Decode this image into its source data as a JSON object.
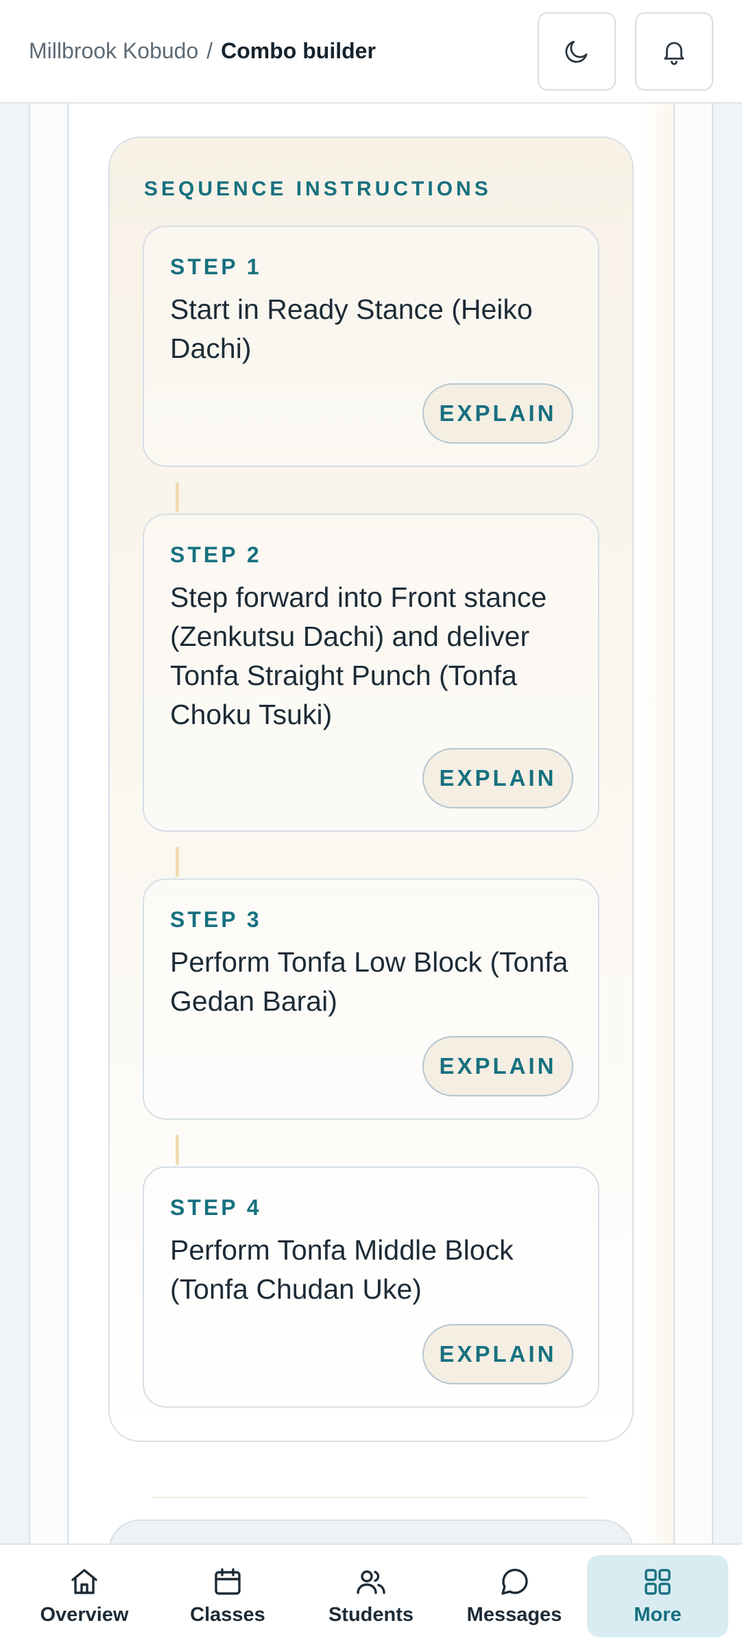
{
  "header": {
    "school_name": "Millbrook Kobudo",
    "separator": "/",
    "page_title": "Combo builder",
    "icons": [
      "moon-icon",
      "bell-icon"
    ]
  },
  "sequence": {
    "title": "SEQUENCE INSTRUCTIONS",
    "steps": [
      {
        "label": "STEP 1",
        "text": "Start in Ready Stance (Heiko Dachi)",
        "button": "EXPLAIN"
      },
      {
        "label": "STEP 2",
        "text": "Step forward into Front stance (Zenkutsu Dachi) and deliver Tonfa Straight Punch (Tonfa Choku Tsuki)",
        "button": "EXPLAIN"
      },
      {
        "label": "STEP 3",
        "text": "Perform Tonfa Low Block (Tonfa Gedan Barai)",
        "button": "EXPLAIN"
      },
      {
        "label": "STEP 4",
        "text": "Perform Tonfa Middle Block (Tonfa Chudan Uke)",
        "button": "EXPLAIN"
      }
    ]
  },
  "nav": {
    "items": [
      {
        "label": "Overview",
        "icon": "home-icon",
        "active": false
      },
      {
        "label": "Classes",
        "icon": "calendar-icon",
        "active": false
      },
      {
        "label": "Students",
        "icon": "users-icon",
        "active": false
      },
      {
        "label": "Messages",
        "icon": "chat-bubble-icon",
        "active": false
      },
      {
        "label": "More",
        "icon": "grid-icon",
        "active": true
      }
    ]
  },
  "colors": {
    "accent": "#17707f",
    "active_nav_bg": "#d8ecf2",
    "card_tint": "#f7f1e6",
    "connector": "#f0dcb0"
  }
}
